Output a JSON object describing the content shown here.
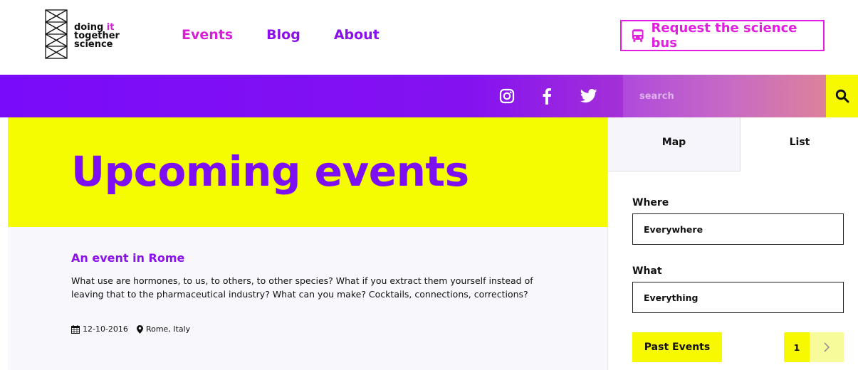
{
  "logo": {
    "line1_prefix": "doing ",
    "line1_highlight": "it",
    "line2": "together",
    "line3": "science"
  },
  "nav": {
    "items": [
      {
        "label": "Events"
      },
      {
        "label": "Blog"
      },
      {
        "label": "About"
      }
    ]
  },
  "header": {
    "bus_button_label": "Request the science bus",
    "bus_icon": "bus-icon"
  },
  "social": {
    "icons": [
      "instagram-icon",
      "facebook-icon",
      "twitter-icon"
    ]
  },
  "search": {
    "placeholder": "search",
    "icon": "search-icon"
  },
  "hero": {
    "title": "Upcoming events"
  },
  "event": {
    "title": "An event in Rome",
    "description": "What use are hormones, to us, to others, to other species? What if you extract them yourself instead of leaving that to the pharmaceutical industry? What can you make? Cocktails, connections, corrections?",
    "date": "12-10-2016",
    "location": "Rome, Italy"
  },
  "sidebar": {
    "tabs": [
      {
        "label": "Map"
      },
      {
        "label": "List"
      }
    ],
    "where_label": "Where",
    "where_value": "Everywhere",
    "what_label": "What",
    "what_value": "Everything",
    "past_events_label": "Past Events",
    "page_number": "1"
  },
  "colors": {
    "purple": "#7d10f2",
    "magenta": "#e21de0",
    "yellow": "#f6f900"
  }
}
